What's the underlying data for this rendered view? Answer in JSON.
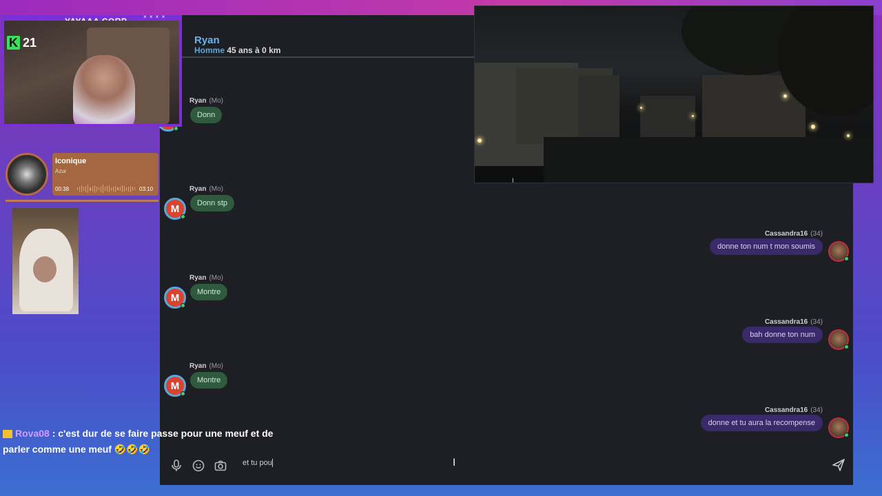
{
  "webcam": {
    "title": "YAYAAA CORP",
    "stars": "× × × ×",
    "viewer_badge": "K",
    "viewer_count": "21"
  },
  "chat_header": {
    "name": "Ryan",
    "gender": "Homme",
    "details": "45 ans à 0 km"
  },
  "messages_left": [
    {
      "sender": "Ryan",
      "meta": "(Mo)",
      "avatar_letter": "",
      "text": "Donn"
    },
    {
      "sender": "Ryan",
      "meta": "(Mo)",
      "avatar_letter": "M",
      "text": "Donn stp"
    },
    {
      "sender": "Ryan",
      "meta": "(Mo)",
      "avatar_letter": "M",
      "text": "Montre"
    },
    {
      "sender": "Ryan",
      "meta": "(Mo)",
      "avatar_letter": "M",
      "text": "Montre"
    }
  ],
  "messages_right": [
    {
      "sender": "Cassandra16",
      "meta": "(34)",
      "text": "donne ton num t mon soumis"
    },
    {
      "sender": "Cassandra16",
      "meta": "(34)",
      "text": "bah donne ton num"
    },
    {
      "sender": "Cassandra16",
      "meta": "(34)",
      "text": "donne et tu aura la recompense"
    }
  ],
  "input": {
    "value": "et tu pou",
    "cursor_glyph": "I"
  },
  "icons": {
    "mic": "microphone-icon",
    "emoji": "emoji-icon",
    "camera": "camera-icon",
    "send": "send-icon"
  },
  "music": {
    "title": "Iconique",
    "artist": "Azur",
    "elapsed": "00:38",
    "duration": "03:10",
    "progress": 0.2
  },
  "stream_chat": {
    "username": "Rova08",
    "separator": " : ",
    "message": "c'est dur de se faire passe pour une meuf et de parler comme une meuf",
    "emojis": " 🤣🤣🤣"
  },
  "video": {
    "overlay_glyph": "I"
  },
  "colors": {
    "chat_bg": "#1e1f24",
    "bubble_left": "#2f5a3e",
    "bubble_right": "#3a2a6a",
    "accent_blue": "#5aa7d9",
    "avatar_red": "#d84430",
    "online": "#3fcf6a"
  }
}
